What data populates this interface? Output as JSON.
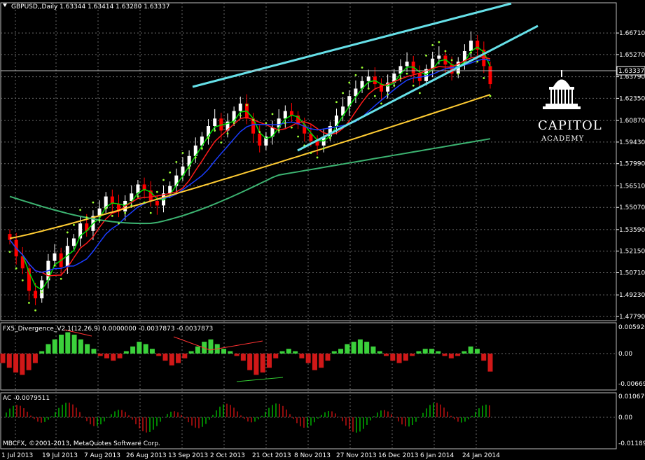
{
  "header": {
    "symbol": "GBPUSD,,Daily",
    "ohlc": "1.63344 1.63414 1.63280 1.63337",
    "current_price": "1.63337"
  },
  "logo": {
    "line1": "CAPITOL",
    "line2": "ACADEMY"
  },
  "indicators": {
    "fx5_label": "FX5_Divergence_V2.1(12,26,9) 0.0000000 -0.0037873 -0.0037873",
    "ac_label": "AC -0.0079511",
    "copyright": "MBCFX, ©2001-2013, MetaQuotes Software Corp."
  },
  "colors": {
    "background": "#000000",
    "grid": "#6a6a6a",
    "bull": "#ffffff",
    "bear": "#ff0000",
    "channel": "#66e0e8",
    "ma_fast": "#00dd00",
    "ma_mid": "#ff1a1a",
    "ma_slow": "#1a3cff",
    "ma_yellow": "#ffcc33",
    "ma_green": "#3cb371",
    "psar": "#9bff33",
    "ac_up": "#00b000",
    "ac_down": "#c01010"
  },
  "chart_data": [
    {
      "type": "candlestick",
      "name": "GBPUSD Daily",
      "x_ticks": [
        "1 Jul 2013",
        "19 Jul 2013",
        "7 Aug 2013",
        "26 Aug 2013",
        "13 Sep 2013",
        "2 Oct 2013",
        "21 Oct 2013",
        "8 Nov 2013",
        "27 Nov 2013",
        "16 Dec 2013",
        "6 Jan 2014",
        "24 Jan 2014"
      ],
      "y_ticks": [
        "1.66710",
        "1.65270",
        "1.63790",
        "1.62350",
        "1.60870",
        "1.59430",
        "1.57990",
        "1.56510",
        "1.55070",
        "1.53590",
        "1.52150",
        "1.50710",
        "1.49230",
        "1.47790"
      ],
      "ylim": [
        1.4779,
        1.6751
      ],
      "approx_closes": [
        1.529,
        1.518,
        1.51,
        1.495,
        1.49,
        1.502,
        1.515,
        1.52,
        1.511,
        1.525,
        1.53,
        1.54,
        1.535,
        1.545,
        1.55,
        1.558,
        1.553,
        1.548,
        1.555,
        1.56,
        1.566,
        1.562,
        1.555,
        1.552,
        1.56,
        1.565,
        1.572,
        1.578,
        1.585,
        1.592,
        1.598,
        1.605,
        1.61,
        1.602,
        1.608,
        1.615,
        1.62,
        1.61,
        1.6,
        1.592,
        1.598,
        1.604,
        1.61,
        1.615,
        1.612,
        1.606,
        1.6,
        1.595,
        1.592,
        1.598,
        1.605,
        1.612,
        1.618,
        1.625,
        1.63,
        1.635,
        1.638,
        1.633,
        1.628,
        1.634,
        1.64,
        1.645,
        1.648,
        1.64,
        1.635,
        1.643,
        1.65,
        1.652,
        1.646,
        1.64,
        1.648,
        1.655,
        1.662,
        1.656,
        1.645,
        1.633
      ],
      "overlays": [
        "channel upper",
        "channel lower",
        "fast MA",
        "mid MA",
        "slow MA",
        "yellow MA",
        "long MA",
        "parabolic SAR"
      ]
    },
    {
      "type": "bar",
      "name": "FX5_Divergence_V2.1(12,26,9)",
      "y_ticks": [
        "0.0059207",
        "0.00",
        "-0.0066922"
      ],
      "ylim": [
        -0.0066922,
        0.0059207
      ],
      "values": [
        -0.002,
        -0.003,
        -0.004,
        -0.0045,
        -0.0035,
        -0.002,
        0.0005,
        0.002,
        0.003,
        0.004,
        0.0045,
        0.004,
        0.003,
        0.002,
        0.001,
        -0.0005,
        -0.001,
        -0.0015,
        -0.001,
        0.0005,
        0.0015,
        0.0025,
        0.002,
        0.001,
        -0.0005,
        -0.0015,
        -0.0025,
        -0.002,
        -0.001,
        0.0005,
        0.0015,
        0.0025,
        0.003,
        0.002,
        0.001,
        0.0005,
        -0.0005,
        -0.0015,
        -0.0035,
        -0.0045,
        -0.004,
        -0.003,
        -0.001,
        0.0005,
        0.001,
        0.0005,
        -0.001,
        -0.002,
        -0.0035,
        -0.003,
        -0.0015,
        0.0005,
        0.001,
        0.002,
        0.0025,
        0.003,
        0.0025,
        0.0015,
        0.0005,
        -0.0005,
        -0.0015,
        -0.002,
        -0.0015,
        -0.0005,
        0.0005,
        0.001,
        0.001,
        0.0005,
        -0.0005,
        -0.001,
        -0.0005,
        0.0005,
        0.0015,
        0.001,
        -0.0015,
        -0.0038
      ]
    },
    {
      "type": "bar",
      "name": "AC",
      "y_ticks": [
        "0.0106792",
        "0.00",
        "-0.0118989"
      ],
      "ylim": [
        -0.0118989,
        0.0106792
      ]
    }
  ]
}
